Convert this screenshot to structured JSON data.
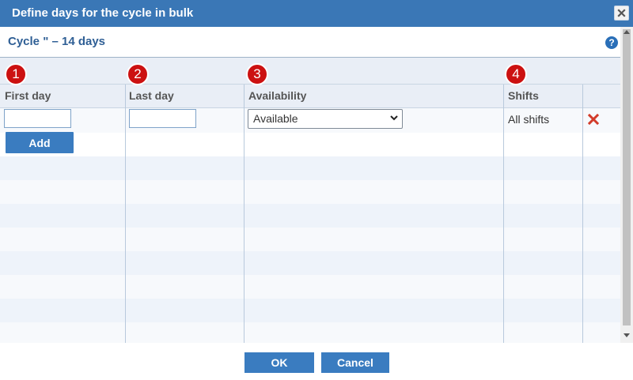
{
  "dialog": {
    "title": "Define days for the cycle in bulk",
    "subtitle": "Cycle \" – 14 days",
    "help_icon": "?",
    "close_icon": "close-icon"
  },
  "steps": [
    "1",
    "2",
    "3",
    "4"
  ],
  "columns": {
    "first_day": "First day",
    "last_day": "Last day",
    "availability": "Availability",
    "shifts": "Shifts"
  },
  "row": {
    "first_day_value": "",
    "last_day_value": "",
    "availability_selected": "Available",
    "shifts_value": "All shifts"
  },
  "buttons": {
    "add": "Add",
    "ok": "OK",
    "cancel": "Cancel"
  },
  "colors": {
    "titlebar": "#3a77b6",
    "button": "#3a7cc0",
    "badge": "#cc1111",
    "delete": "#d23b2a"
  }
}
